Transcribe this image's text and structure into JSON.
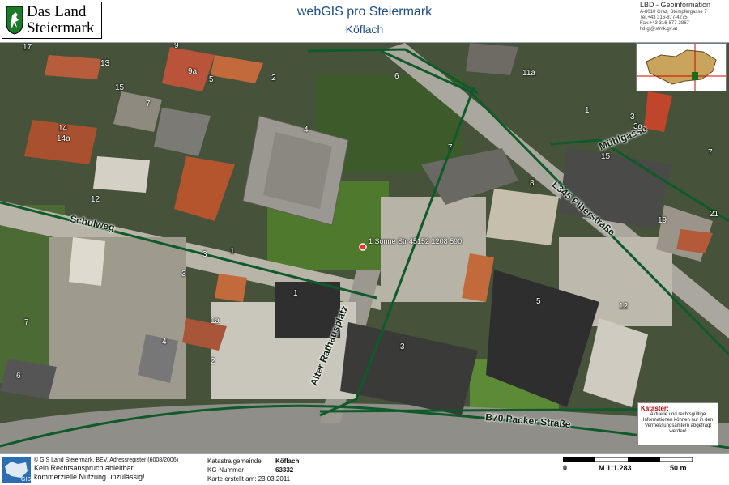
{
  "header": {
    "logo_line1": "Das Land",
    "logo_line2": "Steiermark",
    "title": "webGIS pro Steiermark",
    "subtitle": "Köflach",
    "agency": "LBD - Geoinformation",
    "address": [
      "A-8010 Graz, Stempfergasse 7",
      "Tel.+43 316-877-4275",
      "Fax:+43 316-877-2867",
      "lfd-gi@stmk.gv.at"
    ]
  },
  "map": {
    "streets": {
      "muehlgasse": "Mühlgasse",
      "l345": "L345 Piberstraße",
      "schulweg": "Schulweg",
      "alter_rathausplatz": "Alter Rathausplatz",
      "b70": "B70 Packer Straße"
    },
    "marker_label": "1 Sonne Str 45152 1208 590",
    "house_numbers": [
      "17",
      "9",
      "13",
      "9a",
      "5",
      "2",
      "6",
      "11a",
      "1",
      "3",
      "3a",
      "15",
      "7",
      "14",
      "14a",
      "7",
      "4",
      "7",
      "15",
      "7",
      "12",
      "8",
      "19",
      "21",
      "1",
      "3",
      "3",
      "1",
      "1a",
      "5",
      "12",
      "3",
      "4",
      "2",
      "6"
    ],
    "overview_colors": {
      "land": "#c9a45c",
      "highlight": "#1a6b1a",
      "cross": "#d40000"
    }
  },
  "kataster": {
    "heading": "Kataster:",
    "text": "Aktuelle und rechtsgültige Informationen können nur in den Vermessungsämtern abgefragt werden!"
  },
  "footer": {
    "copyright": "© GIS Land Steiermark, BEV, Adressregister (6008/2006)",
    "disclaimer1": "Kein Rechtsanspruch ableitbar,",
    "disclaimer2": "kommerzielle Nutzung unzulässig!",
    "kg_label": "Katastralgemeinde",
    "kg_value": "Köflach",
    "kgnr_label": "KG-Nummer",
    "kgnr_value": "63332",
    "date_label": "Karte erstellt am: 23.03.2011",
    "scale_start": "0",
    "scale_ratio": "M 1:1.283",
    "scale_end": "50 m"
  },
  "colors": {
    "title": "#1d4f8a",
    "road_line": "#0f5a2a",
    "kataster_heading": "#c00000"
  }
}
